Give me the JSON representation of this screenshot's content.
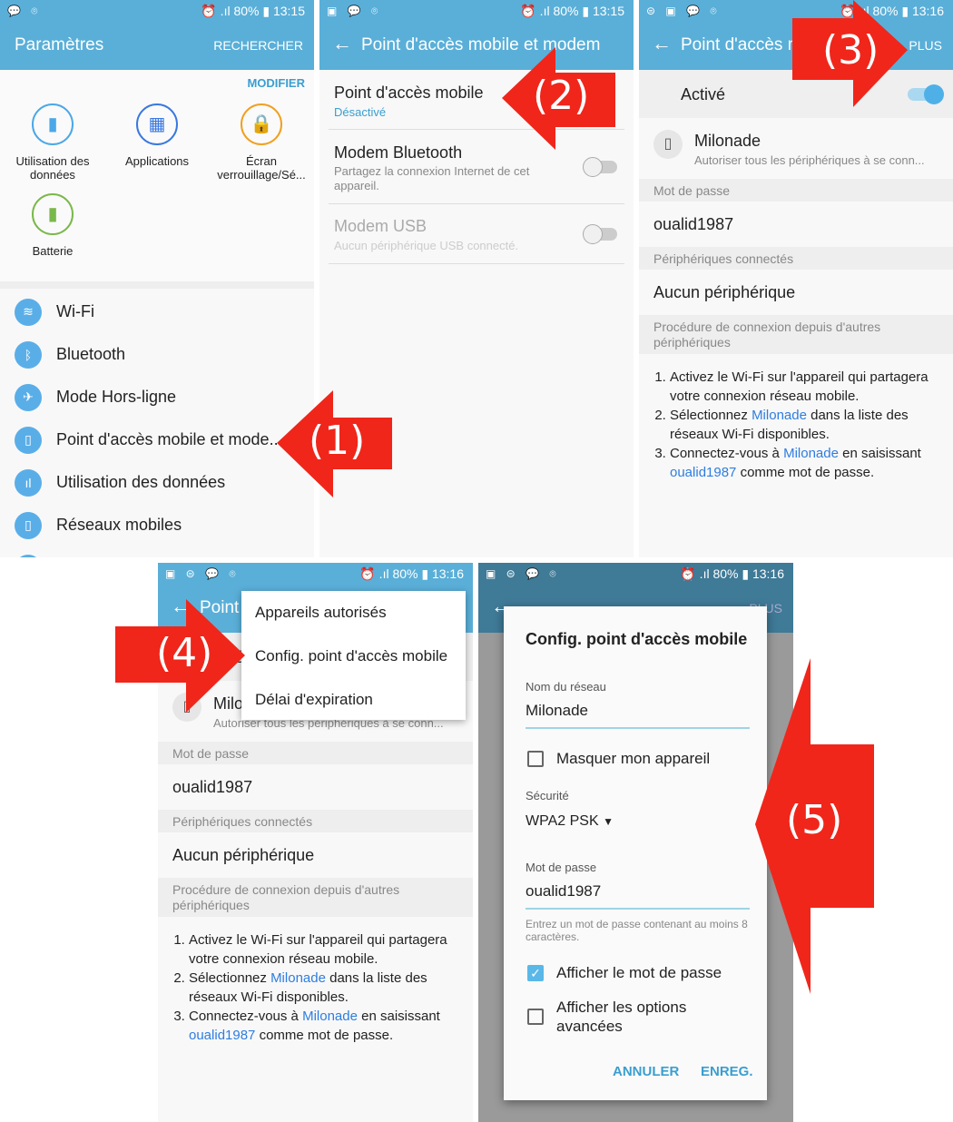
{
  "colors": {
    "header": "#5aafd8",
    "accent": "#3a9ed0",
    "arrow": "#f0261b",
    "link": "#2e7de0"
  },
  "panel1": {
    "status_left": "💬 ⌾",
    "status_right": "⏰ .ıl 80% ▮ 13:15",
    "title": "Paramètres",
    "action": "RECHERCHER",
    "modify": "MODIFIER",
    "shortcuts": [
      {
        "label": "Utilisation des données",
        "icon": "data-usage-icon",
        "color": "#4aa8e8"
      },
      {
        "label": "Applications",
        "icon": "apps-grid-icon",
        "color": "#3a78e0"
      },
      {
        "label": "Écran verrouillage/Sé...",
        "icon": "lock-icon",
        "color": "#f0a020"
      },
      {
        "label": "Batterie",
        "icon": "battery-icon",
        "color": "#7ab84a"
      }
    ],
    "items": [
      {
        "label": "Wi-Fi",
        "icon": "wifi-icon"
      },
      {
        "label": "Bluetooth",
        "icon": "bluetooth-icon"
      },
      {
        "label": "Mode Hors-ligne",
        "icon": "airplane-icon"
      },
      {
        "label": "Point d'accès mobile et mode...",
        "icon": "hotspot-icon"
      },
      {
        "label": "Utilisation des données",
        "icon": "data-usage-icon"
      },
      {
        "label": "Réseaux mobiles",
        "icon": "mobile-network-icon"
      }
    ]
  },
  "panel2": {
    "status_left": "▣ 💬 ⌾",
    "status_right": "⏰ .ıl 80% ▮ 13:15",
    "title": "Point d'accès mobile et modem",
    "hotspot": {
      "title": "Point d'accès mobile",
      "status": "Désactivé"
    },
    "bluetooth": {
      "title": "Modem Bluetooth",
      "desc": "Partagez la connexion Internet de cet appareil.",
      "on": false
    },
    "usb": {
      "title": "Modem USB",
      "desc": "Aucun périphérique USB connecté.",
      "on": false
    }
  },
  "hotspot_detail": {
    "title": "Point d'accès mobile",
    "more": "PLUS",
    "enabled_label": "Activé",
    "enabled": true,
    "network_name": "Milonade",
    "network_desc": "Autoriser tous les périphériques à se conn...",
    "password_header": "Mot de passe",
    "password": "oualid1987",
    "connected_header": "Périphériques connectés",
    "connected_value": "Aucun périphérique",
    "procedure_header": "Procédure de connexion depuis d'autres périphériques",
    "steps": [
      [
        {
          "t": "Activez le Wi-Fi sur l'appareil qui partagera votre connexion réseau mobile."
        }
      ],
      [
        {
          "t": "Sélectionnez "
        },
        {
          "t": "Milonade",
          "link": true
        },
        {
          "t": " dans la liste des réseaux Wi-Fi disponibles."
        }
      ],
      [
        {
          "t": "Connectez-vous à "
        },
        {
          "t": "Milonade",
          "link": true
        },
        {
          "t": " en saisissant "
        },
        {
          "t": "oualid1987",
          "link": true
        },
        {
          "t": " comme mot de passe."
        }
      ]
    ]
  },
  "panel3": {
    "status_left": "⊜ ▣ 💬 ⌾",
    "status_right": "⏰ .ıl 80% ▮ 13:16"
  },
  "panel4": {
    "status_left": "▣ ⊜ 💬 ⌾",
    "status_right": "⏰ .ıl 80% ▮ 13:16",
    "menu": [
      "Appareils autorisés",
      "Config. point d'accès mobile",
      "Délai d'expiration"
    ]
  },
  "panel5": {
    "status_left": "▣ ⊜ 💬 ⌾",
    "status_right": "⏰ .ıl 80% ▮ 13:16",
    "dialog": {
      "title": "Config. point d'accès mobile",
      "network_label": "Nom du réseau",
      "network_value": "Milonade",
      "hide_label": "Masquer mon appareil",
      "hide_checked": false,
      "security_label": "Sécurité",
      "security_value": "WPA2 PSK",
      "password_label": "Mot de passe",
      "password_value": "oualid1987",
      "password_hint": "Entrez un mot de passe contenant au moins 8 caractères.",
      "show_password_label": "Afficher le mot de passe",
      "show_password_checked": true,
      "advanced_label": "Afficher les options avancées",
      "advanced_checked": false,
      "cancel": "ANNULER",
      "save": "ENREG."
    }
  },
  "arrows": [
    "(1)",
    "(2)",
    "(3)",
    "(4)",
    "(5)"
  ]
}
